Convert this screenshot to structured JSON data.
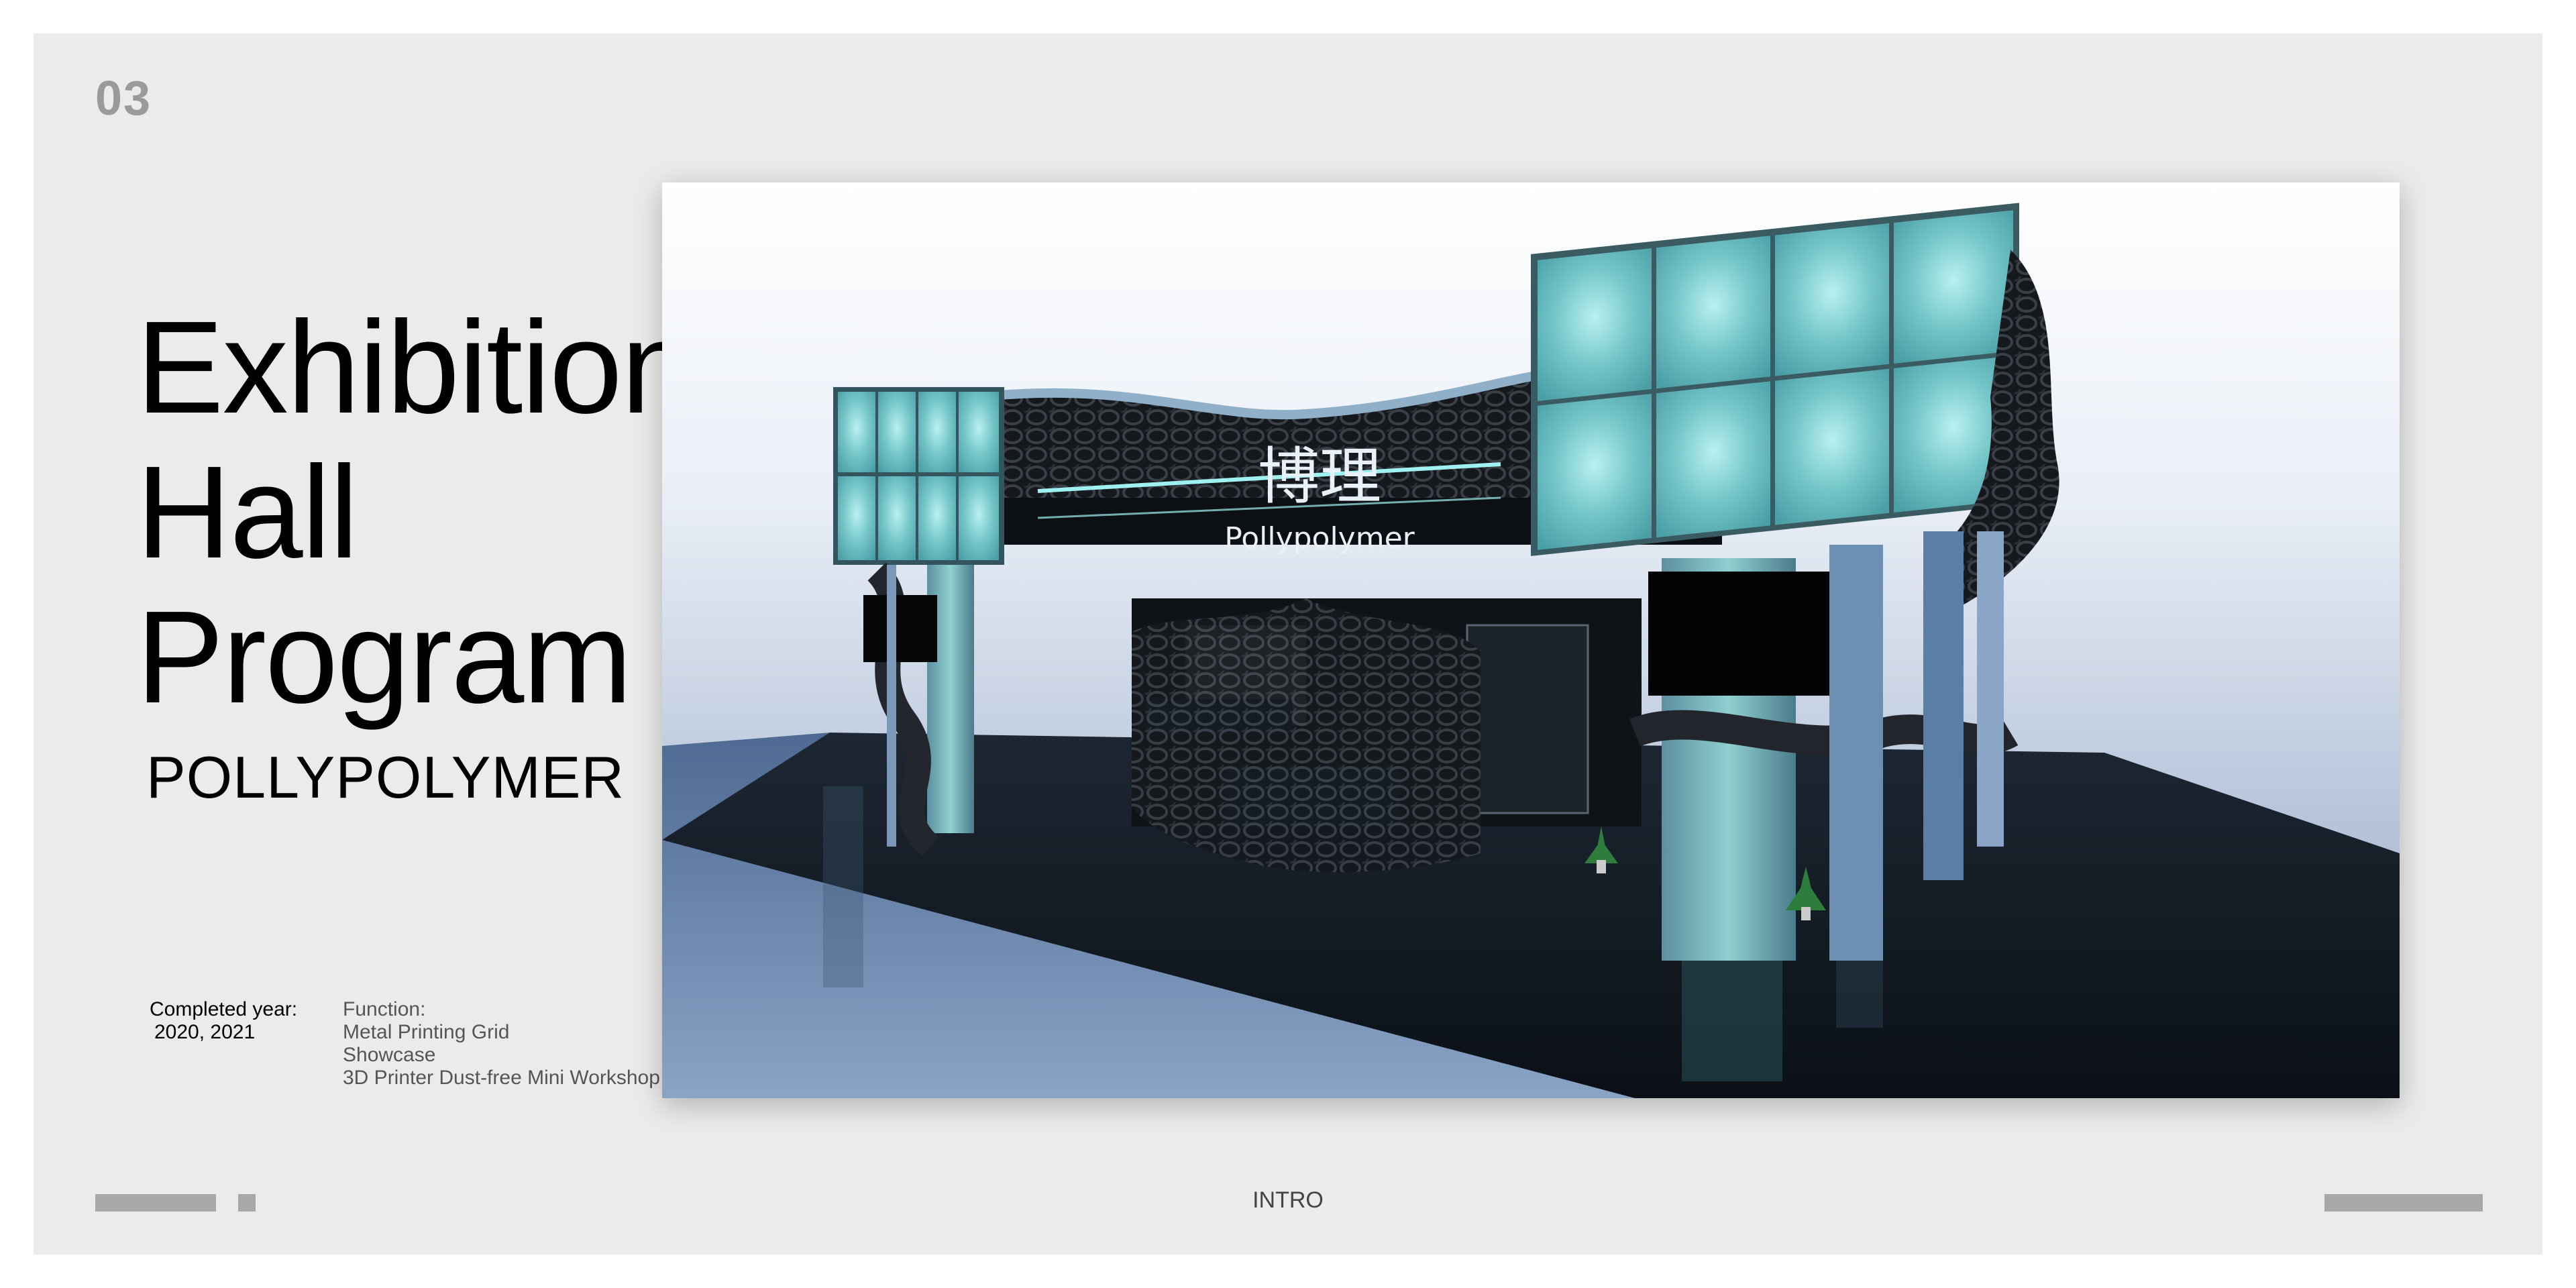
{
  "page": {
    "number": "03",
    "footer_label": "INTRO"
  },
  "title": {
    "line1": "Exhibition",
    "line2": "Hall",
    "line3": "Program",
    "subtitle": "POLLYPOLYMER"
  },
  "details": {
    "completed_label": "Completed year:",
    "completed_value": "2020, 2021",
    "function_label": "Function:",
    "functions": [
      "Metal Printing Grid",
      "Showcase",
      "3D Printer Dust-free Mini Workshop"
    ]
  },
  "rendering": {
    "sign_chinese": "博理",
    "sign_english": "Pollypolymer"
  },
  "colors": {
    "page_background": "#ebebeb",
    "panel_glow": "#7ccfcf",
    "floor": "#5f7fa8",
    "booth_dark": "#111418",
    "footer_bars": "#a8a8a8"
  }
}
